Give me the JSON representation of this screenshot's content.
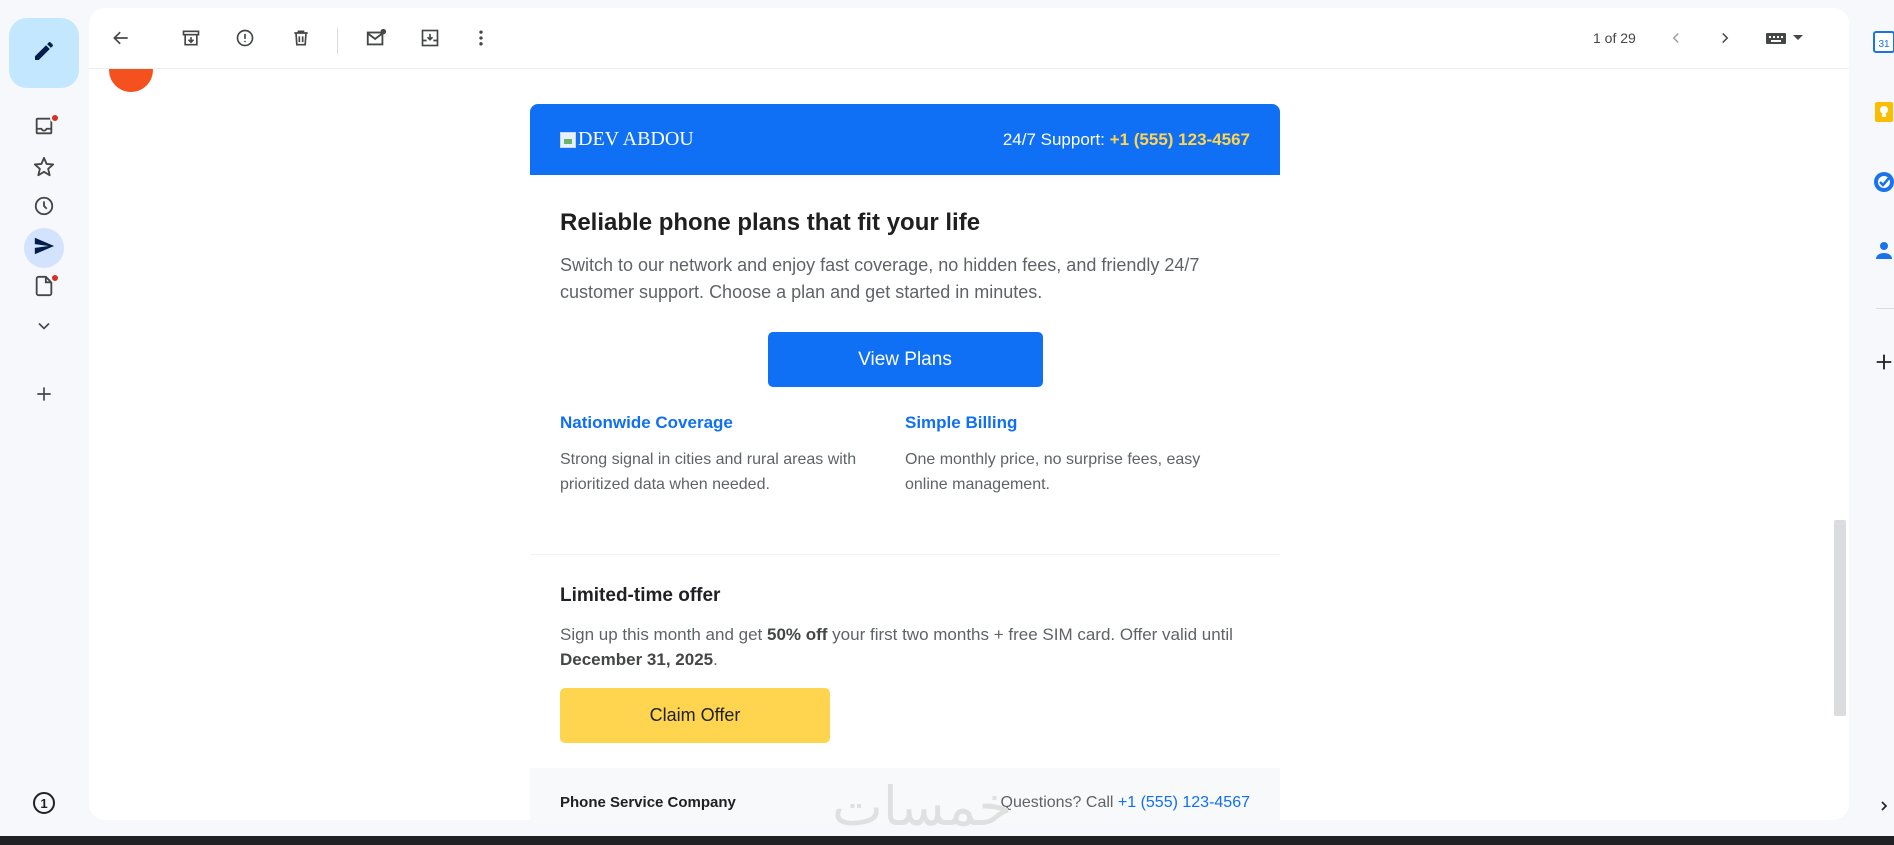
{
  "rail": {
    "compose_icon": "pencil-icon",
    "items": [
      {
        "icon": "inbox-icon",
        "badge": true
      },
      {
        "icon": "star-icon",
        "badge": false
      },
      {
        "icon": "clock-icon",
        "badge": false
      },
      {
        "icon": "send-icon",
        "badge": false,
        "active": true
      },
      {
        "icon": "draft-icon",
        "badge": true
      },
      {
        "icon": "chevron-down-icon",
        "badge": false
      },
      {
        "icon": "plus-icon",
        "badge": false
      }
    ],
    "info_label": "1"
  },
  "toolbar": {
    "icons": [
      "back-arrow-icon",
      "archive-icon",
      "report-spam-icon",
      "delete-icon",
      "mark-unread-icon",
      "move-to-icon",
      "more-vert-icon"
    ],
    "pager_text": "1 of 29",
    "keyboard_icon": "keyboard-icon"
  },
  "email": {
    "header": {
      "logo_alt": "DEV ABDOU",
      "support_label": "24/7 Support: ",
      "support_phone": "+1 (555) 123-4567"
    },
    "headline": "Reliable phone plans that fit your life",
    "intro": "Switch to our network and enjoy fast coverage, no hidden fees, and friendly 24/7 customer support. Choose a plan and get started in minutes.",
    "cta_label": "View Plans",
    "features": [
      {
        "title": "Nationwide Coverage",
        "desc": "Strong signal in cities and rural areas with prioritized data when needed."
      },
      {
        "title": "Simple Billing",
        "desc": "One monthly price, no surprise fees, easy online management."
      }
    ],
    "offer": {
      "title": "Limited-time offer",
      "text_1": "Sign up this month and get ",
      "bold_1": "50% off",
      "text_2": " your first two months + free SIM card. Offer valid until ",
      "bold_2": "December 31, 2025",
      "text_3": ".",
      "button_label": "Claim Offer"
    },
    "footer": {
      "company": "Phone Service Company",
      "question": "Questions? Call ",
      "phone": "+1 (555) 123-4567"
    }
  },
  "watermark": "خمسات",
  "side_panel": {
    "icons": [
      "calendar-icon",
      "keep-icon",
      "tasks-icon",
      "contacts-icon",
      "add-icon"
    ],
    "calendar_day": "31"
  },
  "colors": {
    "brand_blue": "#0f6ff5",
    "accent_yellow": "#ffd54f",
    "badge_red": "#d93025"
  }
}
